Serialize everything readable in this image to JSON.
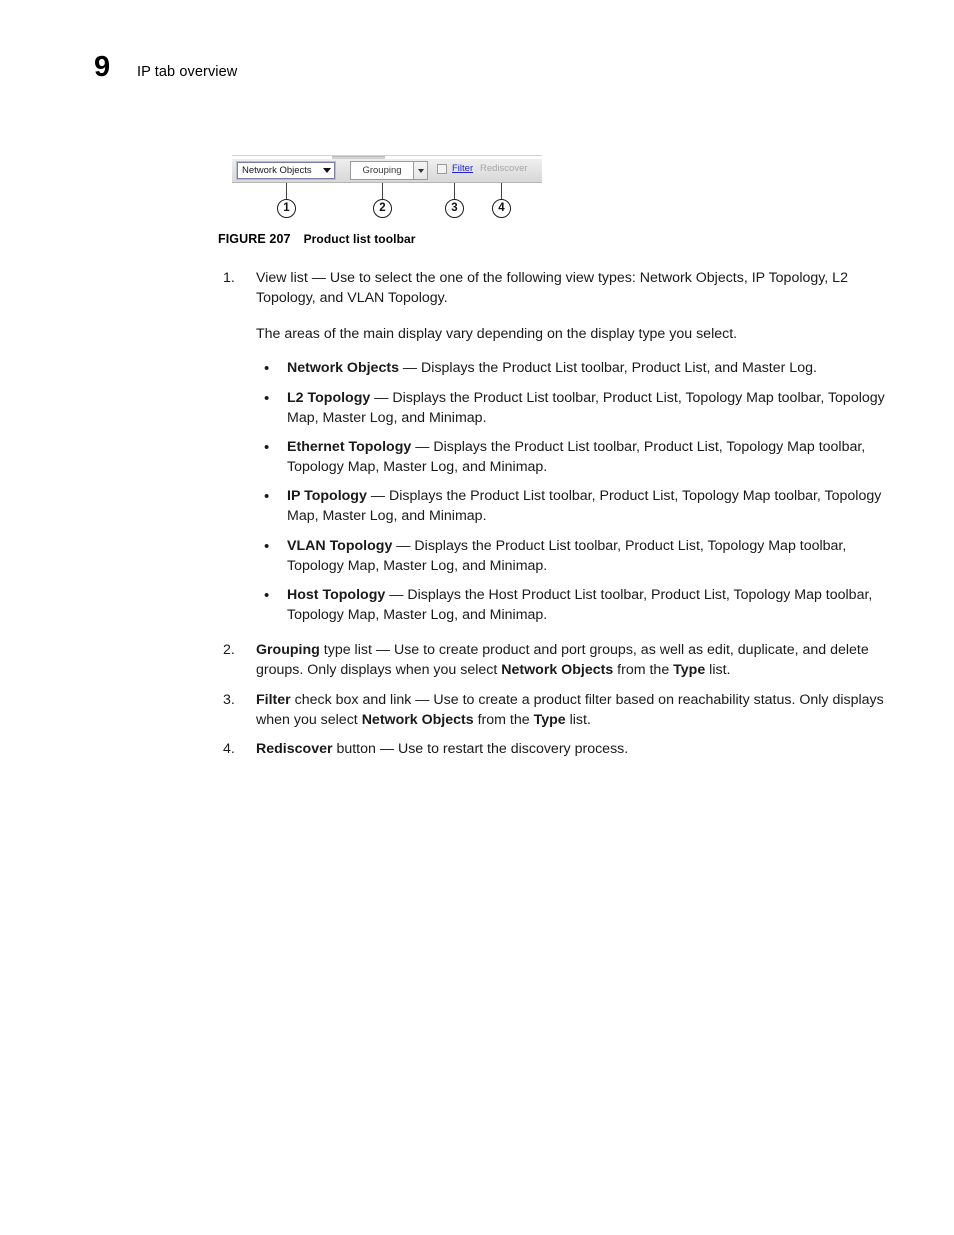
{
  "header": {
    "chapter_number": "9",
    "chapter_title": "IP tab overview"
  },
  "figure": {
    "caption_number": "FIGURE 207",
    "caption_title": "Product list toolbar",
    "toolbar": {
      "view_combo_value": "Network Objects",
      "view_combo_caret": "caret-down-icon",
      "grouping_combo_value": "Grouping",
      "grouping_combo_caret": "caret-down-icon",
      "filter_checkbox_checked": false,
      "filter_link_label": "Filter",
      "rediscover_label": "Rediscover",
      "filter_link_color": "#2222cc",
      "disabled_text_color": "#a8a8a8"
    },
    "callouts": [
      {
        "number": "1"
      },
      {
        "number": "2"
      },
      {
        "number": "3"
      },
      {
        "number": "4"
      }
    ]
  },
  "body": {
    "items": [
      {
        "number": "1.",
        "lead_bold": "",
        "text": "View list — Use to select the one of the following view types: Network Objects, IP Topology, L2 Topology, and VLAN Topology.",
        "sub_paragraph": "The areas of the main display vary depending on the display type you select.",
        "bullets": [
          {
            "term": "Network Objects",
            "description": " — Displays the Product List toolbar, Product List, and Master Log."
          },
          {
            "term": "L2 Topology",
            "description": " — Displays the Product List toolbar, Product List, Topology Map toolbar, Topology Map, Master Log, and Minimap."
          },
          {
            "term": "Ethernet Topology",
            "description": " — Displays the Product List toolbar, Product List, Topology Map toolbar, Topology Map, Master Log, and Minimap."
          },
          {
            "term": "IP Topology",
            "description": " — Displays the Product List toolbar, Product List, Topology Map toolbar, Topology Map, Master Log, and Minimap."
          },
          {
            "term": "VLAN Topology",
            "description": " — Displays the Product List toolbar, Product List, Topology Map toolbar, Topology Map, Master Log, and Minimap."
          },
          {
            "term": "Host Topology",
            "description": " — Displays the Host Product List toolbar, Product List, Topology Map toolbar, Topology Map, Master Log, and Minimap."
          }
        ]
      },
      {
        "number": "2.",
        "parts": [
          {
            "bold": true,
            "text": "Grouping"
          },
          {
            "bold": false,
            "text": " type list — Use to create product and port groups, as well as edit, duplicate, and delete groups. Only displays when you select "
          },
          {
            "bold": true,
            "text": "Network Objects"
          },
          {
            "bold": false,
            "text": " from the "
          },
          {
            "bold": true,
            "text": "Type"
          },
          {
            "bold": false,
            "text": " list."
          }
        ]
      },
      {
        "number": "3.",
        "parts": [
          {
            "bold": true,
            "text": "Filter"
          },
          {
            "bold": false,
            "text": " check box and link — Use to create a product filter based on reachability status. Only displays when you select "
          },
          {
            "bold": true,
            "text": "Network Objects"
          },
          {
            "bold": false,
            "text": " from the "
          },
          {
            "bold": true,
            "text": "Type"
          },
          {
            "bold": false,
            "text": " list."
          }
        ]
      },
      {
        "number": "4.",
        "parts": [
          {
            "bold": true,
            "text": "Rediscover"
          },
          {
            "bold": false,
            "text": " button — Use to restart the discovery process."
          }
        ]
      }
    ]
  }
}
